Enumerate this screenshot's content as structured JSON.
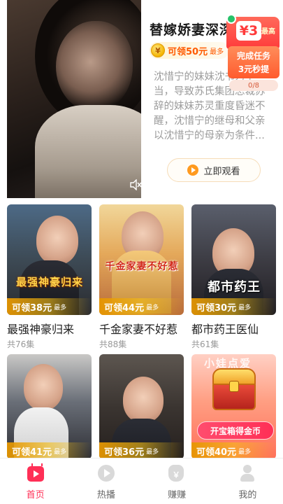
{
  "featured": {
    "title": "替嫁娇妻深深爱",
    "coin_symbol": "¥",
    "coin_amount": "可领50元",
    "coin_max": "最多",
    "description": "沈惜宁的妹妹沈书为不当，导致苏氏集团总裁苏辞的妹妹苏灵重度昏迷不醒，沈惜宁的继母和父亲以沈惜宁的母亲为条件...",
    "watch_label": "立即观看"
  },
  "task": {
    "amount": "¥3",
    "max": "最高",
    "line1": "完成任务",
    "line2": "3元秒提",
    "progress": "0/8"
  },
  "dramas": [
    {
      "title": "最强神豪归来",
      "episodes": "共76集",
      "reward": "可领38元",
      "reward_max": "最多",
      "art": "最强神豪归来"
    },
    {
      "title": "千金家妻不好惹",
      "episodes": "共88集",
      "reward": "可领44元",
      "reward_max": "最多",
      "art": "千金家妻不好惹"
    },
    {
      "title": "都市药王医仙",
      "episodes": "共61集",
      "reward": "可领30元",
      "reward_max": "最多",
      "art": "都市药王"
    },
    {
      "title": "",
      "episodes": "",
      "reward": "可领41元",
      "reward_max": "最多",
      "art": ""
    },
    {
      "title": "",
      "episodes": "",
      "reward": "可领36元",
      "reward_max": "最多",
      "art": ""
    },
    {
      "title": "",
      "episodes": "",
      "reward": "可领40元",
      "reward_max": "最多",
      "art": "小娃点爱",
      "promo": "开宝箱得金币"
    }
  ],
  "nav": [
    {
      "label": "首页",
      "icon": "home-video-icon",
      "active": true
    },
    {
      "label": "热播",
      "icon": "play-circle-icon",
      "active": false
    },
    {
      "label": "赚赚",
      "icon": "money-bag-icon",
      "active": false
    },
    {
      "label": "我的",
      "icon": "user-icon",
      "active": false
    }
  ],
  "colors": {
    "accent": "#ff2f56",
    "coin": "#ff5a00",
    "task": "#ff3b3b",
    "gold": "#f5be14"
  }
}
